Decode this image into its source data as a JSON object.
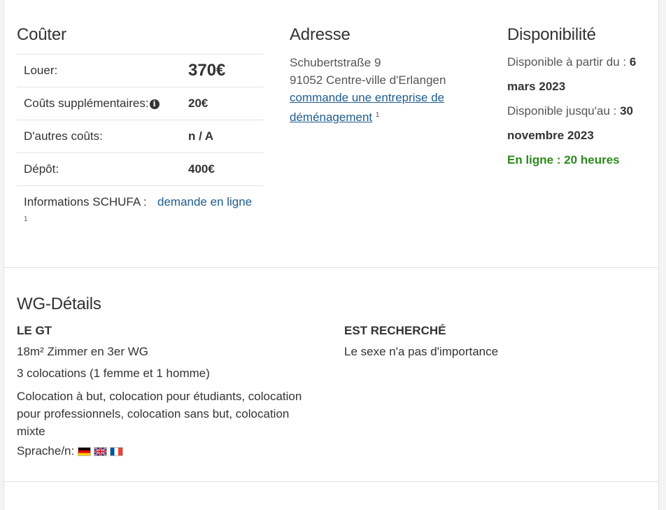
{
  "costs": {
    "title": "Coûter",
    "rows": [
      {
        "label": "Louer:",
        "value": "370€"
      },
      {
        "label": "Coûts supplémentaires:",
        "value": "20€"
      },
      {
        "label": "D'autres coûts:",
        "value": "n / A"
      },
      {
        "label": "Dépôt:",
        "value": "400€"
      }
    ],
    "schufa_label": "Informations SCHUFA :",
    "schufa_link": "demande en ligne",
    "schufa_footnote": "1"
  },
  "address": {
    "title": "Adresse",
    "street": "Schubertstraße 9",
    "city": "91052 Centre-ville d'Erlangen",
    "moving_link": "commande une entreprise de déménagement",
    "moving_link_line1": "commande une entreprise de",
    "moving_link_line2": "déménagement",
    "footnote": "1"
  },
  "availability": {
    "title": "Disponibilité",
    "from_label": "Disponible à partir du :",
    "from_date_1": "6",
    "from_date_2": "mars 2023",
    "until_label": "Disponible jusqu'au :",
    "until_date_1": "30",
    "until_date_2": "novembre 2023",
    "online": "En ligne : 20 heures"
  },
  "wg": {
    "title": "WG-Détails",
    "left_heading": "LE GT",
    "room": "18m² Zimmer en 3er WG",
    "flatmates": "3 colocations (1 femme et 1 homme)",
    "types": "Colocation à but, colocation pour étudiants, colocation pour professionnels, colocation sans but, colocation mixte",
    "languages_label": "Sprache/n:",
    "languages": [
      "german-flag-icon",
      "uk-flag-icon",
      "french-flag-icon"
    ],
    "right_heading": "EST RECHERCHÉ",
    "sought": "Le sexe n'a pas d'importance"
  },
  "colors": {
    "link": "#1f5c8f",
    "online": "#2b8a1a"
  }
}
